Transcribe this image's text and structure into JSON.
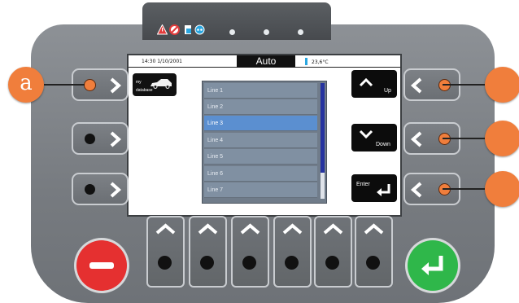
{
  "status_bar": {
    "time_date": "14:30 1/10/2001",
    "mode": "Auto",
    "temperature": "23,6°C"
  },
  "database_button": {
    "line1": "my",
    "line2": "database"
  },
  "list": {
    "items": [
      "Line 1",
      "Line 2",
      "Line 3",
      "Line 4",
      "Line 5",
      "Line 6",
      "Line 7"
    ],
    "selected_index": 2
  },
  "nav_buttons": {
    "up": "Up",
    "down": "Down",
    "enter": "Enter"
  },
  "callouts": {
    "left_label": "a"
  },
  "top_icons": [
    "warning-icon",
    "no-entry-icon",
    "document-icon",
    "network-icon"
  ],
  "colors": {
    "accent_orange": "#f07e3c",
    "cancel_red": "#e53030",
    "confirm_green": "#2fb74a",
    "selection_blue": "#5b8fd0"
  }
}
